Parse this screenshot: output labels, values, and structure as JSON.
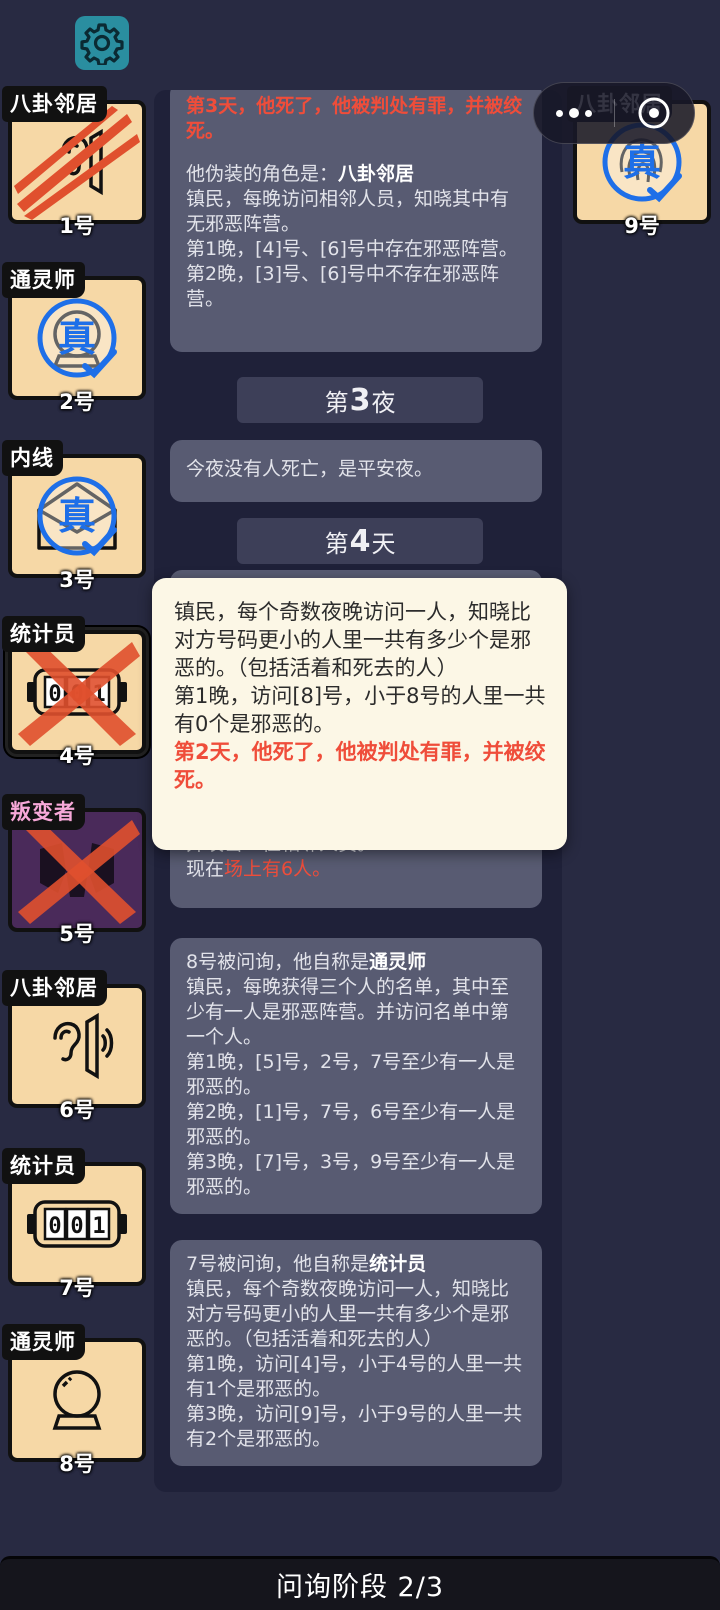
{
  "players": [
    {
      "role": "八卦邻居",
      "number": "1号",
      "icon": "ear-speaker-icon",
      "status": "attacked",
      "stamp": ""
    },
    {
      "role": "通灵师",
      "number": "2号",
      "icon": "crystal-ball-icon",
      "status": "verified",
      "stamp": "真"
    },
    {
      "role": "内线",
      "number": "3号",
      "icon": "envelope-icon",
      "status": "verified",
      "stamp": "真"
    },
    {
      "role": "统计员",
      "number": "4号",
      "icon": "counter-icon",
      "status": "dead",
      "stamp": "",
      "counter": "001"
    },
    {
      "role": "叛变者",
      "number": "5号",
      "icon": "mask-icon",
      "status": "dead",
      "stamp": ""
    },
    {
      "role": "八卦邻居",
      "number": "6号",
      "icon": "ear-speaker-icon",
      "status": "alive",
      "stamp": ""
    },
    {
      "role": "统计员",
      "number": "7号",
      "icon": "counter-icon",
      "status": "alive",
      "stamp": "",
      "counter": "001"
    },
    {
      "role": "通灵师",
      "number": "8号",
      "icon": "crystal-ball-icon",
      "status": "alive",
      "stamp": ""
    },
    {
      "role": "八卦邻居",
      "number": "9号",
      "icon": "fingerprint-icon",
      "status": "verified",
      "stamp": "真"
    }
  ],
  "log": {
    "msg1": {
      "red": "第3天，他死了，他被判处有罪，并被绞死。",
      "disguise_prefix": "他伪装的角色是：",
      "disguise_role": "八卦邻居",
      "desc": "镇民，每晚访问相邻人员，知晓其中有无邪恶阵营。",
      "line1": "第1晚，[4]号、[6]号中存在邪恶阵营。",
      "line2": "第2晚，[3]号、[6]号中不存在邪恶阵营。"
    },
    "phase_night3": {
      "prefix": "第",
      "num": "3",
      "suffix": "夜"
    },
    "msg2": "今夜没有人死亡，是平安夜。",
    "phase_day4": {
      "prefix": "第",
      "num": "4",
      "suffix": "天"
    },
    "msg3": {
      "line1": "并攻击一位相邻人员。",
      "prefix": "现在",
      "red": "场上有6人。"
    },
    "msg4": {
      "intro": "8号被问询，他自称是",
      "role": "通灵师",
      "desc": "镇民，每晚获得三个人的名单，其中至少有一人是邪恶阵营。并访问名单中第一个人。",
      "line1": "第1晚，[5]号，2号，7号至少有一人是邪恶的。",
      "line2": "第2晚，[1]号，7号，6号至少有一人是邪恶的。",
      "line3": "第3晚，[7]号，3号，9号至少有一人是邪恶的。"
    },
    "msg5": {
      "intro": "7号被问询，他自称是",
      "role": "统计员",
      "desc": "镇民，每个奇数夜晚访问一人，知晓比对方号码更小的人里一共有多少个是邪恶的。（包括活着和死去的人）",
      "line1": "第1晚，访问[4]号，小于4号的人里一共有1个是邪恶的。",
      "line2": "第3晚，访问[9]号，小于9号的人里一共有2个是邪恶的。"
    }
  },
  "popup": {
    "desc": "镇民，每个奇数夜晚访问一人，知晓比对方号码更小的人里一共有多少个是邪恶的。（包括活着和死去的人）",
    "line1": "第1晚，访问[8]号，小于8号的人里一共有0个是邪恶的。",
    "red": "第2天，他死了，他被判处有罪，并被绞死。"
  },
  "bottom_bar": {
    "label": "问询阶段 2/3"
  },
  "colors": {
    "accent_red": "#ef4d3a",
    "card_bg": "#f6d8a6",
    "stamp_blue": "#1e6fe8",
    "gear_bg": "#2a8ea0"
  }
}
